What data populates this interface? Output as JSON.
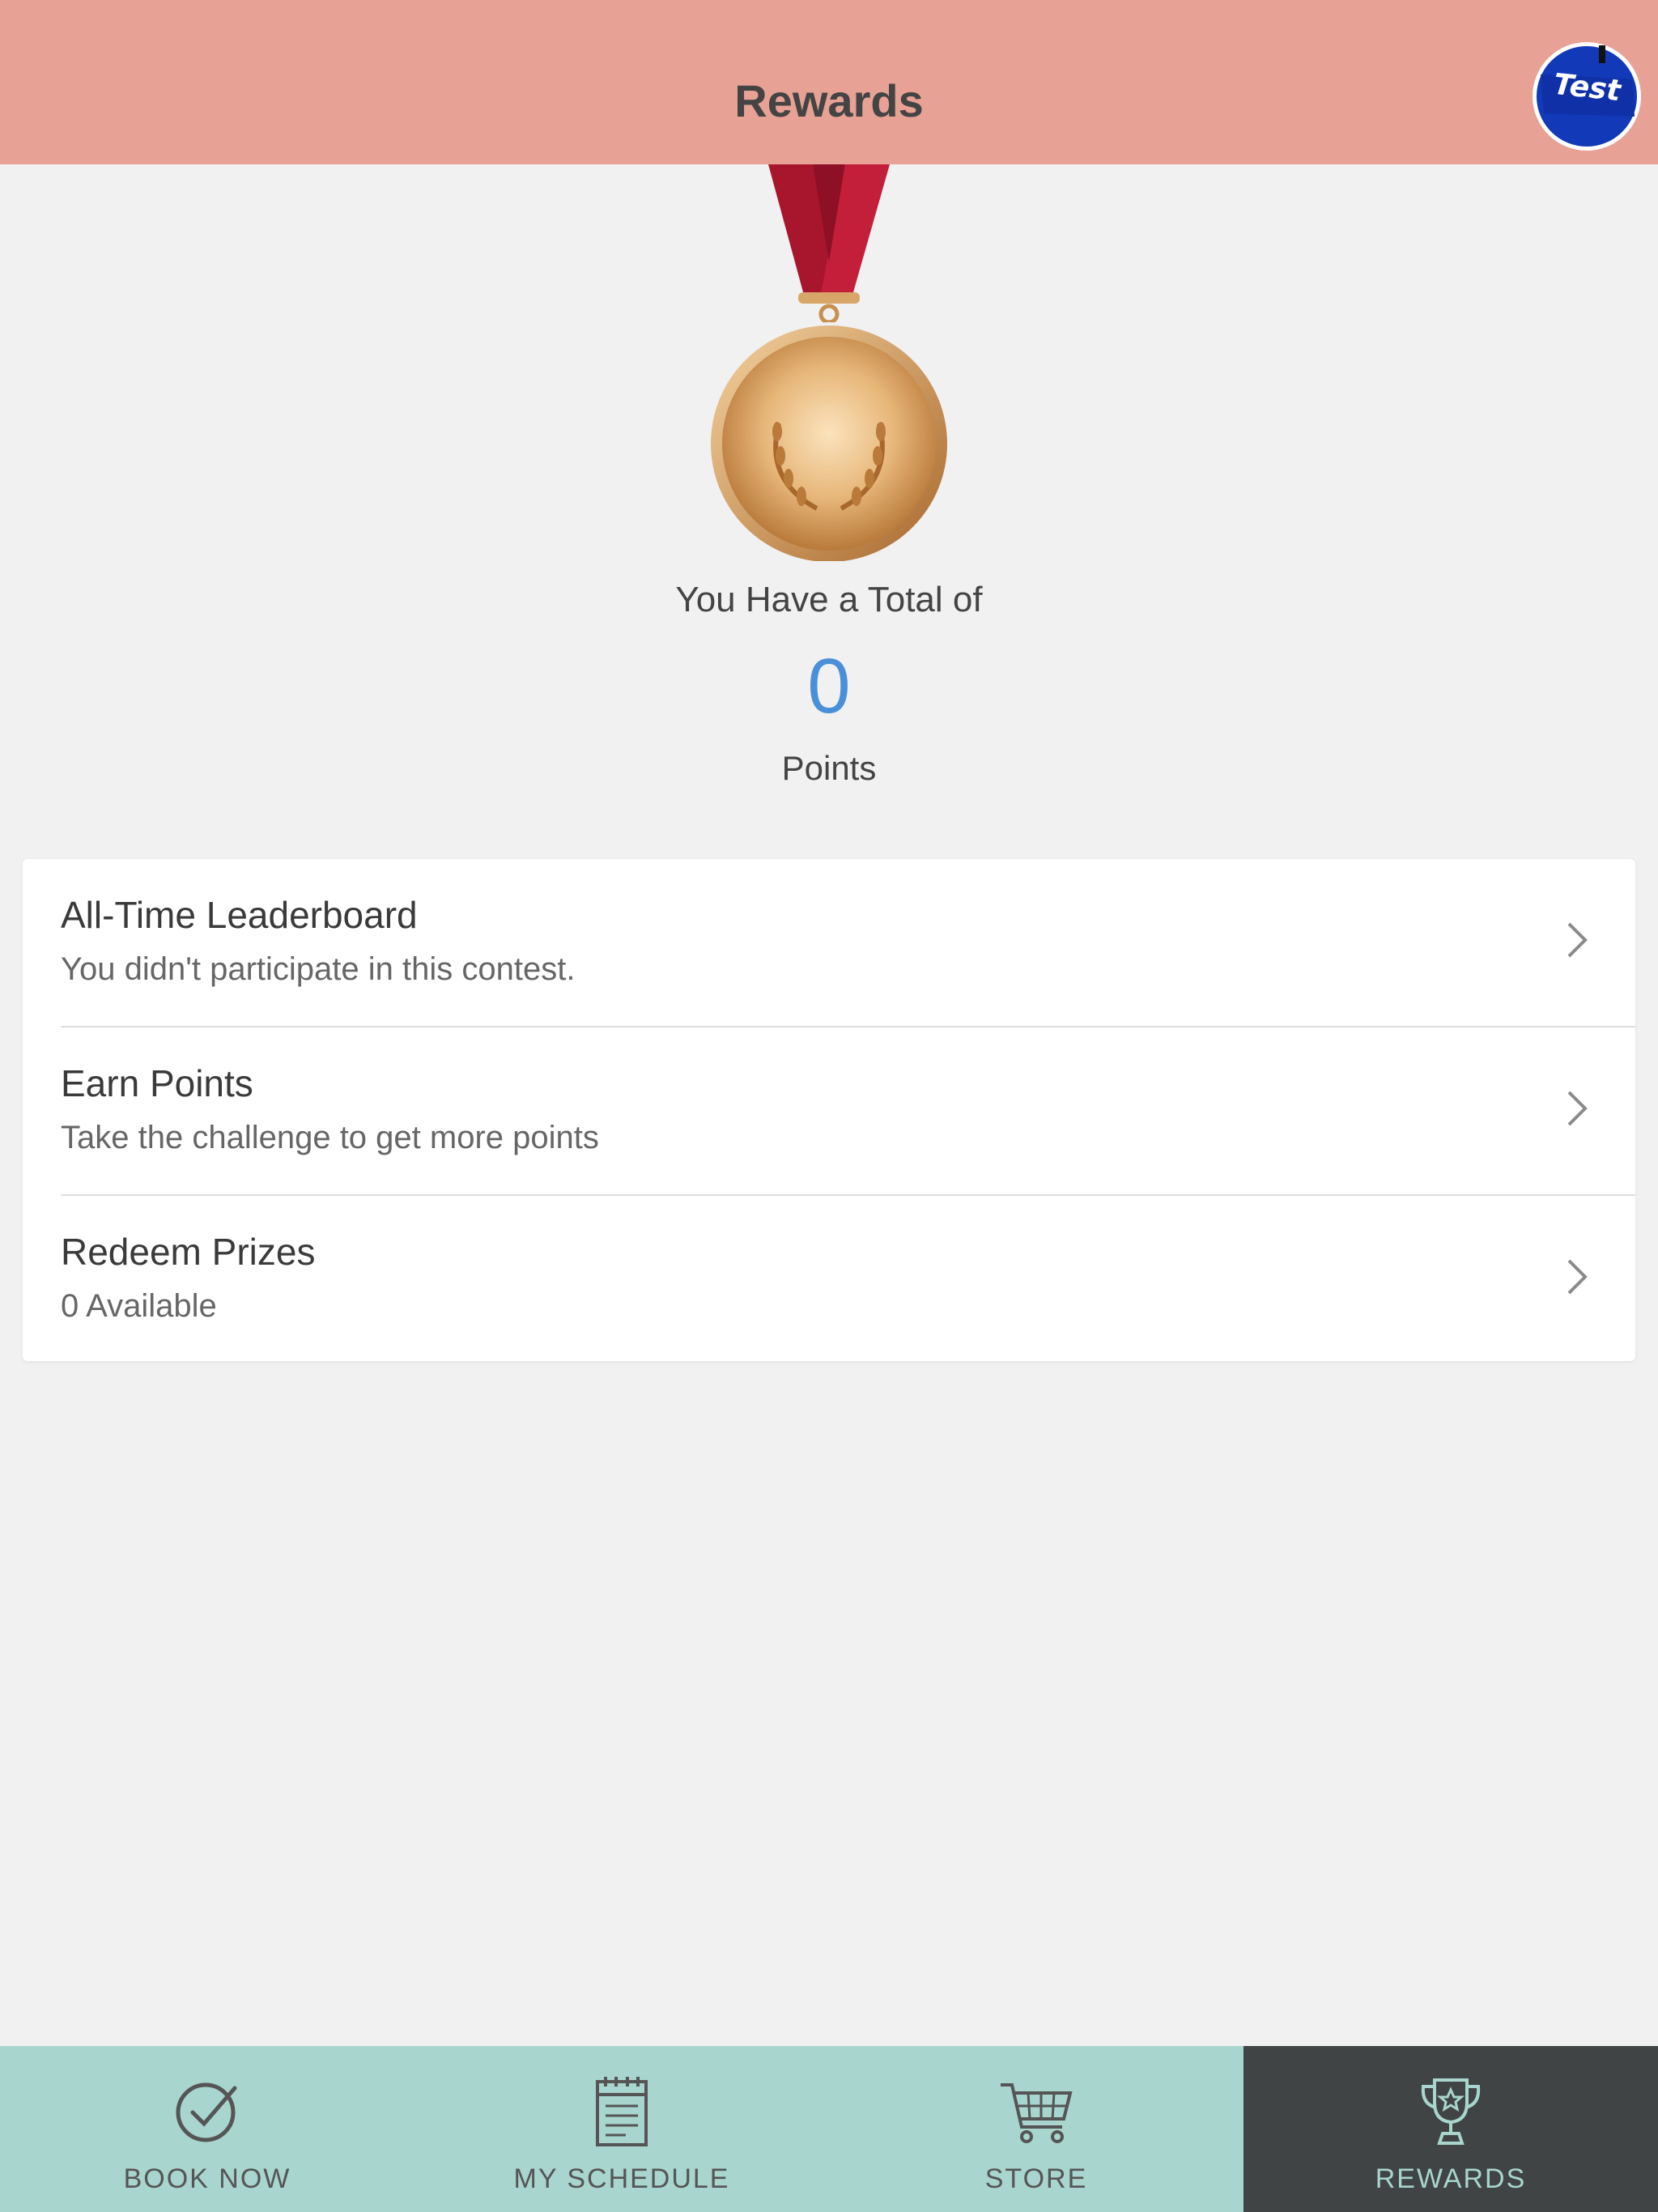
{
  "header": {
    "title": "Rewards",
    "avatar_text": "Test"
  },
  "summary": {
    "total_label": "You Have a Total of",
    "points_value": "0",
    "points_label": "Points"
  },
  "menu": {
    "items": [
      {
        "title": "All-Time Leaderboard",
        "subtitle": "You didn't participate in this contest."
      },
      {
        "title": "Earn Points",
        "subtitle": "Take the challenge to get more points"
      },
      {
        "title": "Redeem Prizes",
        "subtitle": "0 Available"
      }
    ]
  },
  "tabs": [
    {
      "label": "BOOK NOW",
      "icon": "check-circle-icon",
      "active": false
    },
    {
      "label": "MY SCHEDULE",
      "icon": "calendar-icon",
      "active": false
    },
    {
      "label": "STORE",
      "icon": "cart-icon",
      "active": false
    },
    {
      "label": "REWARDS",
      "icon": "trophy-icon",
      "active": true
    }
  ],
  "colors": {
    "header_bg": "#e8a195",
    "tabbar_bg": "#a8d5cd",
    "active_tab_bg": "#404444",
    "points_accent": "#4a90d9",
    "page_bg": "#f1f1f1"
  }
}
